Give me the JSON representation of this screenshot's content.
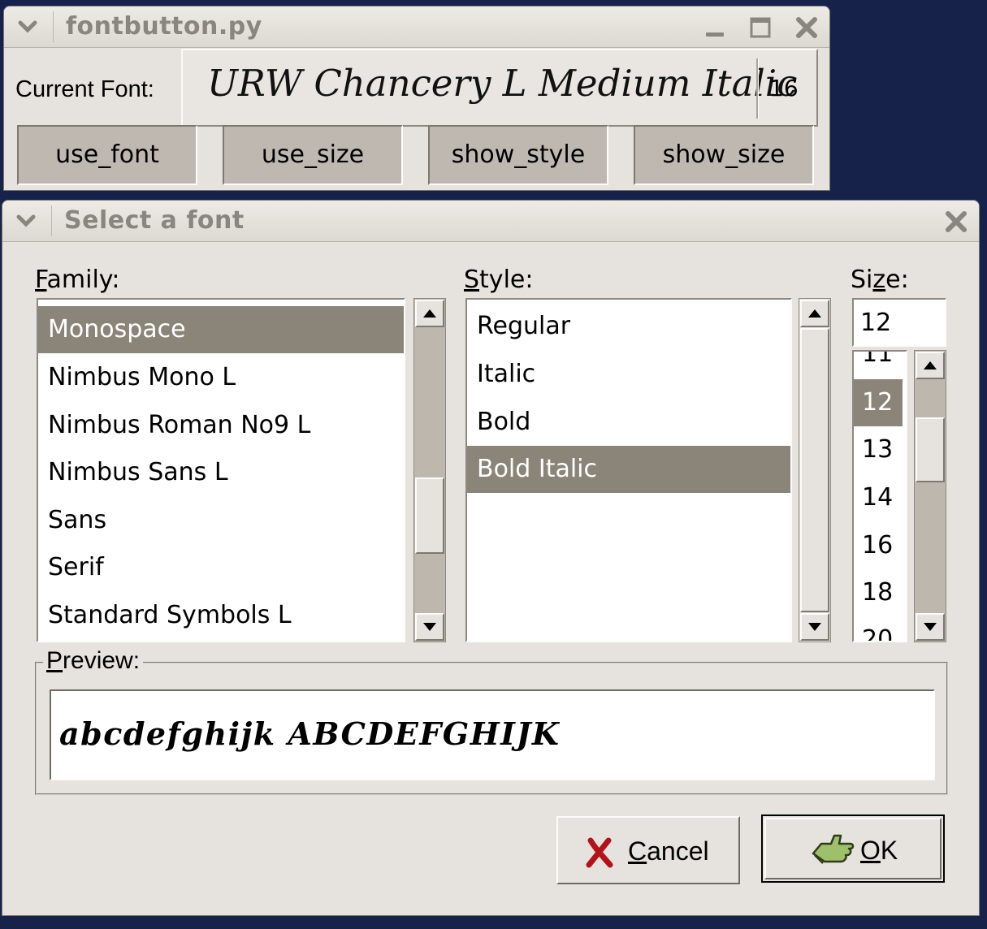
{
  "main_window": {
    "title": "fontbutton.py",
    "current_font_label": "Current Font:",
    "font_button": {
      "font_name": "URW Chancery L Medium Italic",
      "size": "16"
    },
    "toggles": [
      "use_font",
      "use_size",
      "show_style",
      "show_size"
    ]
  },
  "dialog": {
    "title": "Select a font",
    "family": {
      "label_mnemonic": "F",
      "label_rest": "amily:",
      "items": [
        "Monospace",
        "Nimbus Mono L",
        "Nimbus Roman No9 L",
        "Nimbus Sans L",
        "Sans",
        "Serif",
        "Standard Symbols L"
      ],
      "selected": "Monospace"
    },
    "style": {
      "label_mnemonic": "S",
      "label_rest": "tyle:",
      "items": [
        "Regular",
        "Italic",
        "Bold",
        "Bold Italic"
      ],
      "selected": "Bold Italic"
    },
    "size": {
      "label_pre": "Si",
      "label_mnemonic": "z",
      "label_rest": "e:",
      "value": "12",
      "items": [
        "11",
        "12",
        "13",
        "14",
        "16",
        "18",
        "20"
      ],
      "selected": "12"
    },
    "preview": {
      "label_mnemonic": "P",
      "label_rest": "review:",
      "text": "abcdefghijk ABCDEFGHIJK"
    },
    "buttons": {
      "cancel_mnemonic": "C",
      "cancel_rest": "ancel",
      "ok_mnemonic": "O",
      "ok_rest": "K"
    }
  },
  "icons": {
    "window_menu": "chevron-down-icon",
    "minimize": "minimize-icon",
    "maximize": "maximize-icon",
    "close": "close-icon",
    "cancel": "cancel-x-icon",
    "ok": "ok-hand-icon"
  },
  "colors": {
    "desktop": "#16224a",
    "selection": "#8b8479",
    "window_bg": "#e6e3de"
  }
}
